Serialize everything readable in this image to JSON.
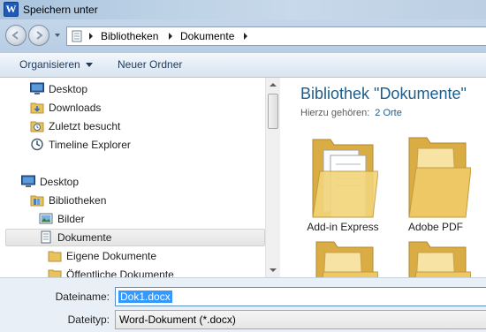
{
  "window": {
    "title": "Speichern unter",
    "app_icon_letter": "W"
  },
  "address_bar": {
    "breadcrumbs": [
      "Bibliotheken",
      "Dokumente"
    ]
  },
  "toolbar": {
    "organize_label": "Organisieren",
    "new_folder_label": "Neuer Ordner"
  },
  "nav_pane": {
    "favorites": [
      {
        "label": "Desktop",
        "icon": "desktop-icon"
      },
      {
        "label": "Downloads",
        "icon": "downloads-folder-icon"
      },
      {
        "label": "Zuletzt besucht",
        "icon": "recent-places-icon"
      },
      {
        "label": "Timeline Explorer",
        "icon": "timeline-icon"
      }
    ],
    "tree": [
      {
        "label": "Desktop",
        "icon": "desktop-icon",
        "selected": false
      },
      {
        "label": "Bibliotheken",
        "icon": "libraries-icon",
        "selected": false
      },
      {
        "label": "Bilder",
        "icon": "pictures-library-icon",
        "selected": false
      },
      {
        "label": "Dokumente",
        "icon": "documents-library-icon",
        "selected": true
      },
      {
        "label": "Eigene Dokumente",
        "icon": "folder-icon",
        "selected": false
      },
      {
        "label": "Öffentliche Dokumente",
        "icon": "folder-icon",
        "selected": false
      }
    ]
  },
  "content": {
    "library_title": "Bibliothek \"Dokumente\"",
    "includes_label": "Hierzu gehören:",
    "includes_link": "2 Orte",
    "items": [
      {
        "label": "Add-in Express",
        "icon": "folder-with-documents-icon"
      },
      {
        "label": "Adobe PDF",
        "icon": "folder-icon"
      },
      {
        "label": "",
        "icon": "folder-icon"
      },
      {
        "label": "",
        "icon": "folder-icon"
      }
    ]
  },
  "form": {
    "filename_label": "Dateiname:",
    "filename_value": "Dok1.docx",
    "filetype_label": "Dateityp:",
    "filetype_value": "Word-Dokument (*.docx)"
  },
  "colors": {
    "accent": "#1e5c8a",
    "selection": "#3399ff",
    "folder": "#e8c25a"
  }
}
